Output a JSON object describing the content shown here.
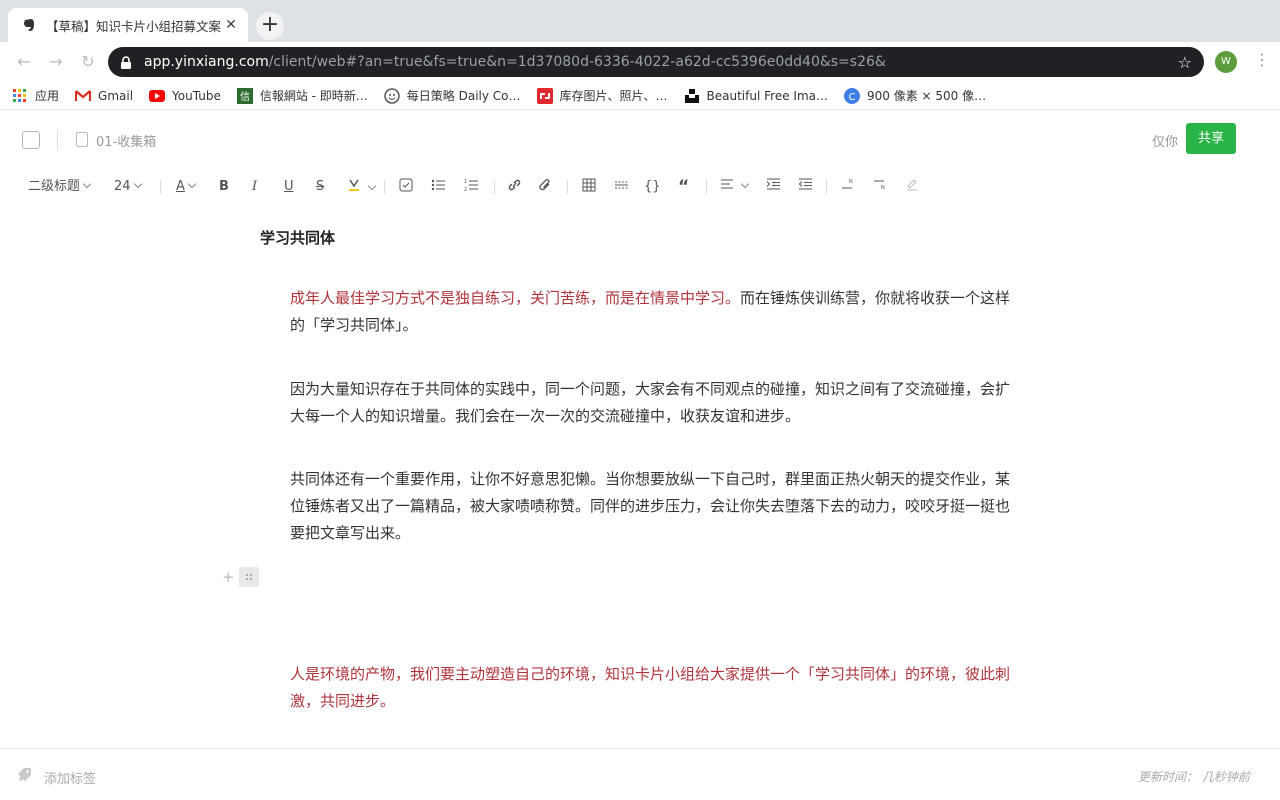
{
  "browser": {
    "tab_title": "【草稿】知识卡片小组招募文案",
    "tab_close": "✕",
    "new_tab": "+",
    "url_host": "app.yinxiang.com",
    "url_rest": "/client/web#?an=true&fs=true&n=1d37080d-6336-4022-a62d-cc5396e0dd40&s=s26&",
    "profile_initial": "W",
    "bookmarks": [
      {
        "label": "应用",
        "icon": "apps-grid-icon"
      },
      {
        "label": "Gmail",
        "icon": "gmail-icon"
      },
      {
        "label": "YouTube",
        "icon": "youtube-icon"
      },
      {
        "label": "信報網站 - 即時新…",
        "icon": "hkej-icon"
      },
      {
        "label": "每日策略 Daily Co…",
        "icon": "daily-strategy-icon"
      },
      {
        "label": "库存图片、照片、…",
        "icon": "shutterstock-icon"
      },
      {
        "label": "Beautiful Free Ima…",
        "icon": "unsplash-icon"
      },
      {
        "label": "900 像素 × 500 像…",
        "icon": "canva-icon"
      }
    ]
  },
  "editor": {
    "notebook": "01-收集箱",
    "visibility": "仅你",
    "share_label": "共享",
    "format": {
      "heading": "二级标题",
      "font_size": "24"
    },
    "heading": "学习共同体",
    "paragraphs": {
      "p1_red": "成年人最佳学习方式不是独自练习，关门苦练，而是在情景中学习。",
      "p1_rest": "而在锤炼侠训练营，你就将收获一个这样的「学习共同体」。",
      "p2": "因为大量知识存在于共同体的实践中，同一个问题，大家会有不同观点的碰撞，知识之间有了交流碰撞，会扩大每一个人的知识增量。我们会在一次一次的交流碰撞中，收获友谊和进步。",
      "p3": "共同体还有一个重要作用，让你不好意思犯懒。当你想要放纵一下自己时，群里面正热火朝天的提交作业，某位锤炼者又出了一篇精品，被大家啧啧称赞。同伴的进步压力，会让你失去堕落下去的动力，咬咬牙挺一挺也要把文章写出来。",
      "p4": "人是环境的产物，我们要主动塑造自己的环境，知识卡片小组给大家提供一个「学习共同体」的环境，彼此刺激，共同进步。"
    },
    "footer": {
      "add_tag": "添加标签",
      "updated": "更新时间： 几秒钟前"
    }
  },
  "colors": {
    "accent_green": "#28b446",
    "highlight_red": "#b0343c"
  }
}
